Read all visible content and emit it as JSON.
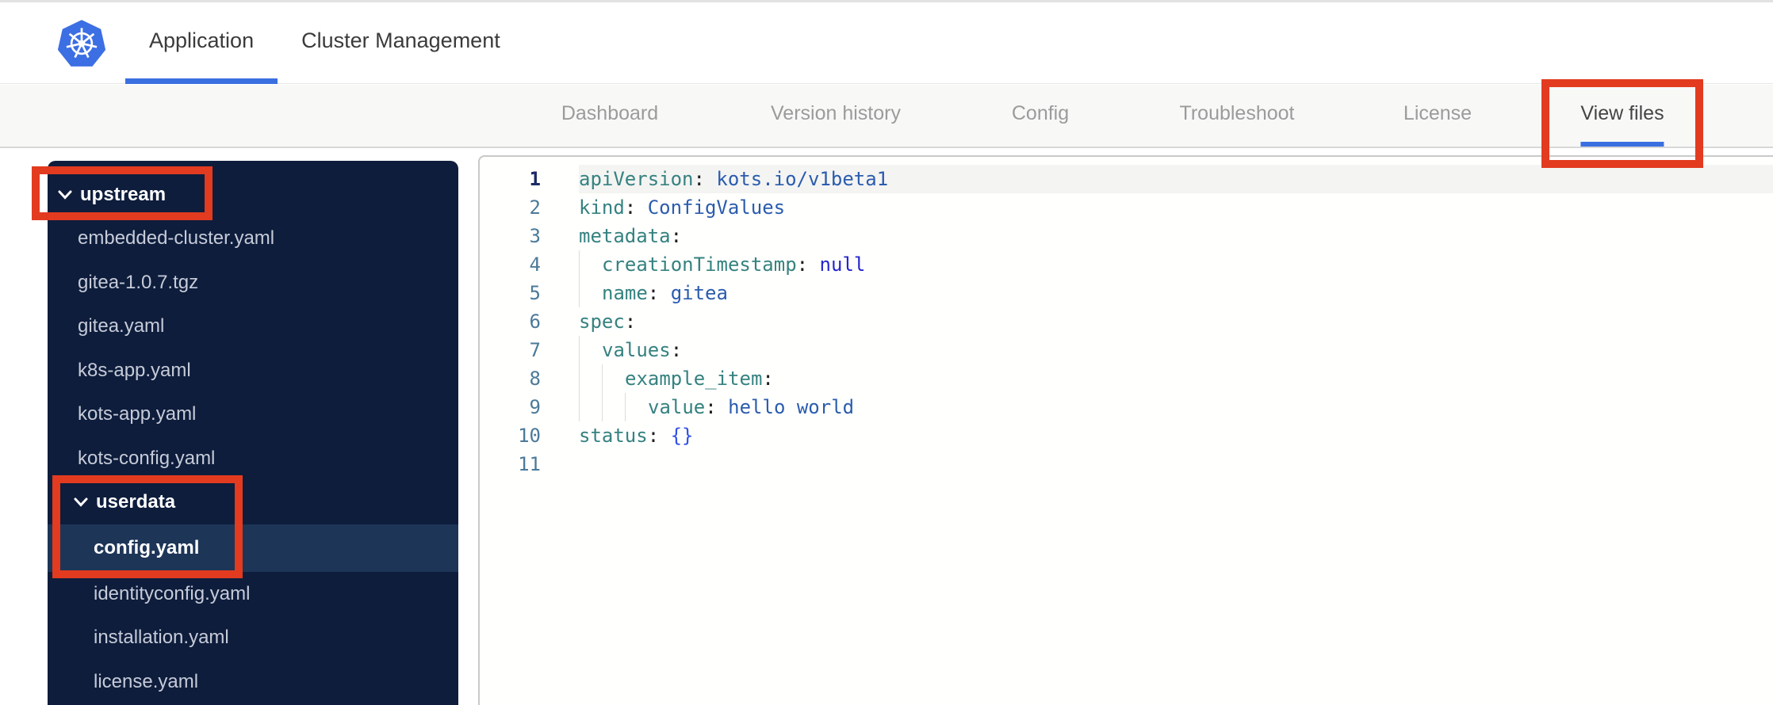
{
  "app": {
    "logo_icon": "kubernetes-helm-wheel",
    "accent_blue": "#3a6fe0",
    "annotation_red": "#e23b20"
  },
  "header": {
    "tabs": [
      {
        "label": "Application",
        "active": true
      },
      {
        "label": "Cluster Management",
        "active": false
      }
    ]
  },
  "nav": {
    "items": [
      {
        "label": "Dashboard",
        "active": false,
        "annotated": false
      },
      {
        "label": "Version history",
        "active": false,
        "annotated": false
      },
      {
        "label": "Config",
        "active": false,
        "annotated": false
      },
      {
        "label": "Troubleshoot",
        "active": false,
        "annotated": false
      },
      {
        "label": "License",
        "active": false,
        "annotated": false
      },
      {
        "label": "View files",
        "active": true,
        "annotated": true
      }
    ]
  },
  "file_tree": {
    "colors": {
      "background": "#0e1d3c",
      "selected_row": "#1d3557",
      "file_text": "#c6cbd8",
      "folder_text": "#ffffff"
    },
    "items": [
      {
        "type": "folder",
        "label": "upstream",
        "level": 0,
        "expanded": true,
        "selected": false,
        "annotated": true
      },
      {
        "type": "file",
        "label": "embedded-cluster.yaml",
        "level": 1,
        "selected": false
      },
      {
        "type": "file",
        "label": "gitea-1.0.7.tgz",
        "level": 1,
        "selected": false
      },
      {
        "type": "file",
        "label": "gitea.yaml",
        "level": 1,
        "selected": false
      },
      {
        "type": "file",
        "label": "k8s-app.yaml",
        "level": 1,
        "selected": false
      },
      {
        "type": "file",
        "label": "kots-app.yaml",
        "level": 1,
        "selected": false
      },
      {
        "type": "file",
        "label": "kots-config.yaml",
        "level": 1,
        "selected": false
      },
      {
        "type": "folder",
        "label": "userdata",
        "level": 1,
        "expanded": true,
        "selected": false,
        "annotated": true
      },
      {
        "type": "file",
        "label": "config.yaml",
        "level": 2,
        "selected": true,
        "annotated": true
      },
      {
        "type": "file",
        "label": "identityconfig.yaml",
        "level": 2,
        "selected": false
      },
      {
        "type": "file",
        "label": "installation.yaml",
        "level": 2,
        "selected": false
      },
      {
        "type": "file",
        "label": "license.yaml",
        "level": 2,
        "selected": false
      }
    ]
  },
  "editor": {
    "language": "yaml",
    "colors": {
      "key": "#35827f",
      "string": "#2b5cad",
      "literal": "#2525cf",
      "brace": "#3150e8",
      "line_number": "#4c7a99",
      "active_line_number": "#1b2a66"
    },
    "lines": [
      {
        "num": "1",
        "indent": 0,
        "key": "apiVersion",
        "value": "kots.io/v1beta1",
        "value_type": "str",
        "active": true
      },
      {
        "num": "2",
        "indent": 0,
        "key": "kind",
        "value": "ConfigValues",
        "value_type": "str",
        "active": false
      },
      {
        "num": "3",
        "indent": 0,
        "key": "metadata",
        "value": "",
        "value_type": "",
        "active": false
      },
      {
        "num": "4",
        "indent": 2,
        "key": "creationTimestamp",
        "value": "null",
        "value_type": "lit",
        "active": false
      },
      {
        "num": "5",
        "indent": 2,
        "key": "name",
        "value": "gitea",
        "value_type": "str",
        "active": false
      },
      {
        "num": "6",
        "indent": 0,
        "key": "spec",
        "value": "",
        "value_type": "",
        "active": false
      },
      {
        "num": "7",
        "indent": 2,
        "key": "values",
        "value": "",
        "value_type": "",
        "active": false
      },
      {
        "num": "8",
        "indent": 4,
        "key": "example_item",
        "value": "",
        "value_type": "",
        "active": false
      },
      {
        "num": "9",
        "indent": 6,
        "key": "value",
        "value": "hello world",
        "value_type": "str",
        "active": false
      },
      {
        "num": "10",
        "indent": 0,
        "key": "status",
        "value": "{}",
        "value_type": "brace",
        "active": false
      },
      {
        "num": "11",
        "indent": 0,
        "key": "",
        "value": "",
        "value_type": "",
        "active": false
      }
    ]
  }
}
